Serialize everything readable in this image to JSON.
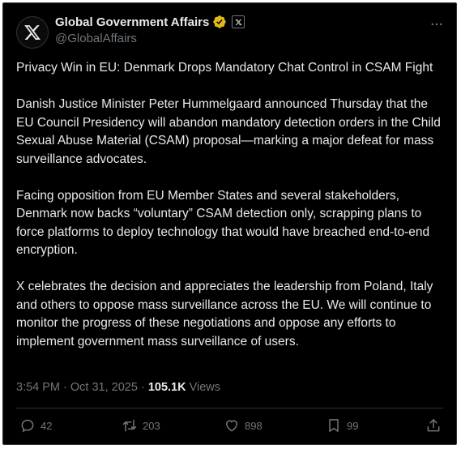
{
  "author": {
    "name": "Global Government Affairs",
    "handle": "@GlobalAffairs",
    "avatar_icon": "x-logo-icon",
    "verified_color": "#e2b719"
  },
  "post": {
    "paragraphs": [
      "Privacy Win in EU: Denmark Drops Mandatory Chat Control in CSAM Fight",
      "Danish Justice Minister Peter Hummelgaard announced Thursday that the EU Council Presidency will abandon mandatory detection orders in the Child Sexual Abuse Material (CSAM) proposal—marking a major defeat for mass surveillance advocates.",
      "Facing opposition from EU Member States and several stakeholders, Denmark now backs “voluntary” CSAM detection only, scrapping plans to force platforms to deploy technology that would have breached end-to-end encryption.",
      "X celebrates the decision and appreciates the leadership from Poland, Italy and others to oppose mass surveillance across the EU. We will continue to monitor the progress of these negotiations and oppose any efforts to implement government mass surveillance of users."
    ],
    "time": "3:54 PM",
    "date": "Oct 31, 2025",
    "views_count": "105.1K",
    "views_label": "Views"
  },
  "actions": {
    "replies": "42",
    "reposts": "203",
    "likes": "898",
    "bookmarks": "99"
  }
}
